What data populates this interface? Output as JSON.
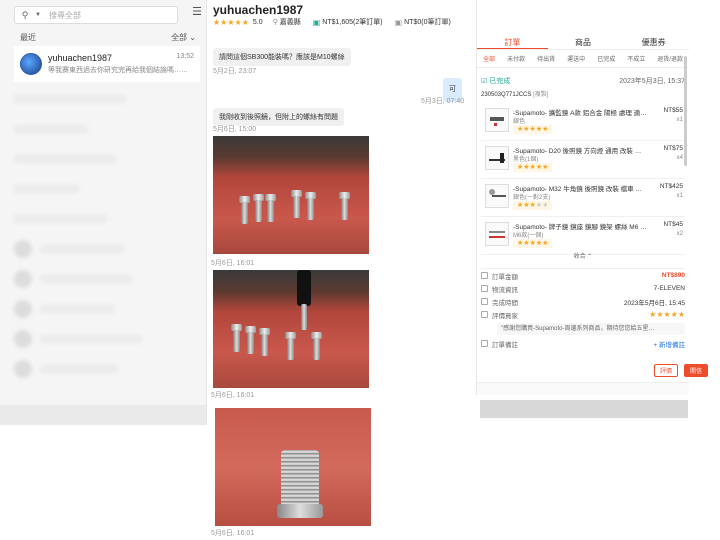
{
  "sidebar": {
    "search_placeholder": "搜尋全部",
    "recent_label": "最近",
    "filter_label": "全部 ⌄",
    "conversation": {
      "name": "yuhuachen1987",
      "time": "13:52",
      "preview": "等我賽東西過去你研究完再給我個結論嗎……"
    }
  },
  "chat": {
    "username": "yuhuachen1987",
    "rating": "5.0",
    "location": "嘉義縣",
    "orders_total": "NT$1,605(2筆訂單)",
    "pending": "NT$0(0筆訂單)",
    "messages": [
      {
        "text": "請問這個SB300能裝嗎？應該是M10螺絲",
        "time": "5月2日, 23:07"
      },
      {
        "text": "可",
        "time": "5月3日, 07:40"
      },
      {
        "text": "我剛收到後照鏡，但附上的螺絲有問題",
        "time": "5月6日, 15:00"
      }
    ],
    "photo_times": [
      "5月6日, 16:01",
      "5月6日, 16:01",
      "5月6日, 16:01"
    ]
  },
  "panel": {
    "main_tabs": [
      "訂單",
      "商品",
      "優惠券"
    ],
    "sub_tabs": [
      "全部",
      "未付款",
      "待出貨",
      "運送中",
      "已完成",
      "不成立",
      "退貨/退款"
    ],
    "order": {
      "status": "已完成",
      "date": "2023年5月3日, 15:37",
      "id": "23050​3Q771JCCS",
      "copy": "[複製]"
    },
    "items": [
      {
        "name": "-Supamoto- 擴監鏡 A款 鋁合金 陽極 處理 適用 黃…",
        "variant": "銀色",
        "price": "NT$55",
        "qty": "x1",
        "stars": 5
      },
      {
        "name": "-Supamoto- D20 後照鏡 方向燈 通用 改裝 強彈 金屬…",
        "variant": "黑色(1個)",
        "price": "NT$75",
        "qty": "x4",
        "stars": 5
      },
      {
        "name": "-Supamoto- M32 牛角鏡 後照鏡 改裝 檔車 還原 後…",
        "variant": "銀色(一對2支)",
        "price": "NT$425",
        "qty": "x1",
        "stars": 3
      },
      {
        "name": "-Supamoto- 牌子鏡 鏡座 鏡腳 鏡架 螺絲 M6 M8 M…",
        "variant": "M6款(一個)",
        "price": "NT$45",
        "qty": "x2",
        "stars": 5
      }
    ],
    "collapse": "收合 ⌃",
    "summary": {
      "total_label": "訂單金額",
      "total_value": "NT$890",
      "logistics_label": "物流資訊",
      "logistics_value": "7-ELEVEN",
      "complete_label": "完成時間",
      "complete_value": "2023年5月6日, 15:45",
      "review_label": "評價買家",
      "review_text": "\"感謝您購買-Supamoto-周邊系列商品，期待您您給五星…",
      "note_label": "訂單備註",
      "note_link": "+ 新增備註"
    },
    "actions": [
      "評價",
      "開信"
    ]
  },
  "colors": {
    "accent": "#ee4d2d",
    "star": "#f5a623",
    "teal": "#26aa99"
  }
}
